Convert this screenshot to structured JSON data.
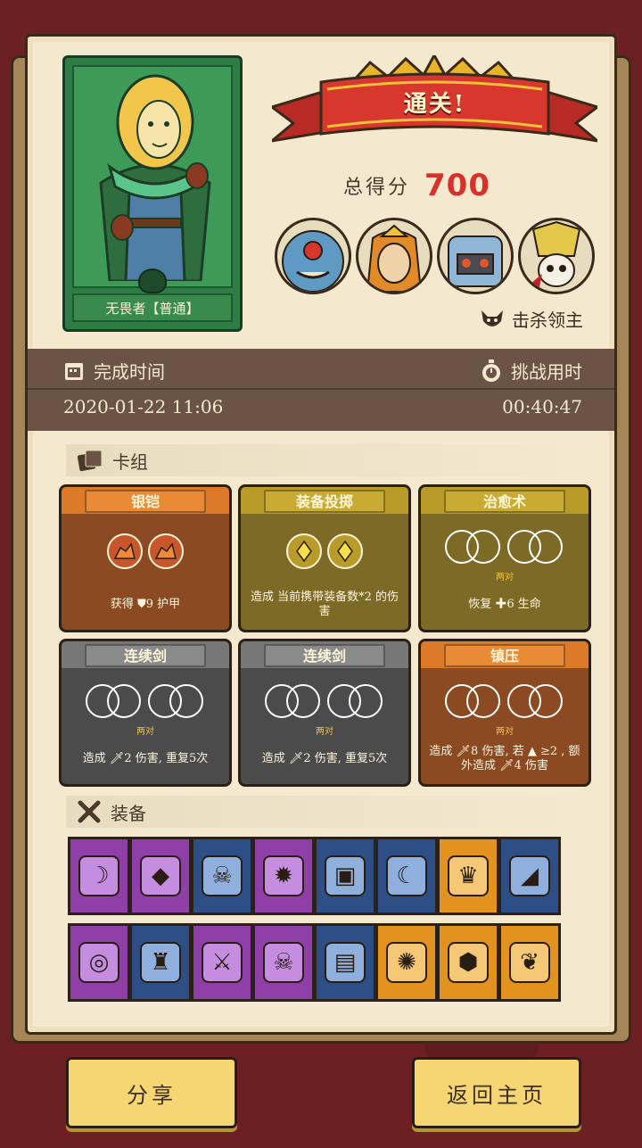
{
  "hero": {
    "name": "无畏者【普通】"
  },
  "result": {
    "banner": "通关!",
    "score_label": "总得分",
    "score": "700"
  },
  "bosses": [
    {
      "icon": "cyclops-monster-portrait",
      "color": "#5f9ac4"
    },
    {
      "icon": "dragon-king-portrait",
      "color": "#e08a2a"
    },
    {
      "icon": "ice-golem-portrait",
      "color": "#8fb6d6"
    },
    {
      "icon": "skull-knight-portrait",
      "color": "#e5c84a"
    }
  ],
  "kill_label": "击杀领主",
  "time": {
    "complete_label": "完成时间",
    "complete_value": "2020-01-22 11:06",
    "challenge_label": "挑战用时",
    "challenge_value": "00:40:47"
  },
  "deck": {
    "header": "卡组",
    "cards": [
      {
        "title": "银铠",
        "desc": "获得 ⛊9 护甲",
        "sub": "",
        "style": "orange"
      },
      {
        "title": "装备投掷",
        "desc": "造成 当前携带装备数*2 的伤害",
        "sub": "",
        "style": "olive"
      },
      {
        "title": "治愈术",
        "desc": "恢复 ✚6 生命",
        "sub": "两对",
        "style": "olive"
      },
      {
        "title": "连续剑",
        "desc": "造成 🗡2 伤害, 重复5次",
        "sub": "两对",
        "style": "gray"
      },
      {
        "title": "连续剑",
        "desc": "造成 🗡2 伤害, 重复5次",
        "sub": "两对",
        "style": "gray"
      },
      {
        "title": "镇压",
        "desc": "造成 🗡8 伤害, 若 ▲ ≥2 , 额外造成 🗡4 伤害",
        "sub": "两对",
        "style": "orange"
      }
    ]
  },
  "equipment": {
    "header": "装备",
    "row1": [
      {
        "icon": "sickle-icon",
        "color": "purple",
        "glyph": "☽"
      },
      {
        "icon": "ruby-gem-icon",
        "color": "purple",
        "glyph": "◆"
      },
      {
        "icon": "skull-mask-icon",
        "color": "blue",
        "glyph": "☠"
      },
      {
        "icon": "fire-orb-icon",
        "color": "purple",
        "glyph": "✹"
      },
      {
        "icon": "red-tome-icon",
        "color": "blue",
        "glyph": "▣"
      },
      {
        "icon": "moon-staff-icon",
        "color": "blue",
        "glyph": "☾"
      },
      {
        "icon": "demon-helm-icon",
        "color": "orange",
        "glyph": "♛"
      },
      {
        "icon": "war-horn-icon",
        "color": "blue",
        "glyph": "◢"
      }
    ],
    "row2": [
      {
        "icon": "golden-ring-icon",
        "color": "purple",
        "glyph": "◎"
      },
      {
        "icon": "gold-helmet-icon",
        "color": "blue",
        "glyph": "♜"
      },
      {
        "icon": "dagger-icon",
        "color": "purple",
        "glyph": "⚔"
      },
      {
        "icon": "skull-book-icon",
        "color": "purple",
        "glyph": "☠"
      },
      {
        "icon": "bandage-scroll-icon",
        "color": "blue",
        "glyph": "▤"
      },
      {
        "icon": "spiked-mace-icon",
        "color": "orange",
        "glyph": "✺"
      },
      {
        "icon": "ice-shield-icon",
        "color": "orange",
        "glyph": "⬢"
      },
      {
        "icon": "green-feather-icon",
        "color": "orange",
        "glyph": "❦"
      }
    ]
  },
  "buttons": {
    "share": "分享",
    "home": "返回主页"
  },
  "colors": {
    "score": "#d8312b",
    "time_bg": "#6b5446",
    "paper": "#f4e9cf"
  }
}
